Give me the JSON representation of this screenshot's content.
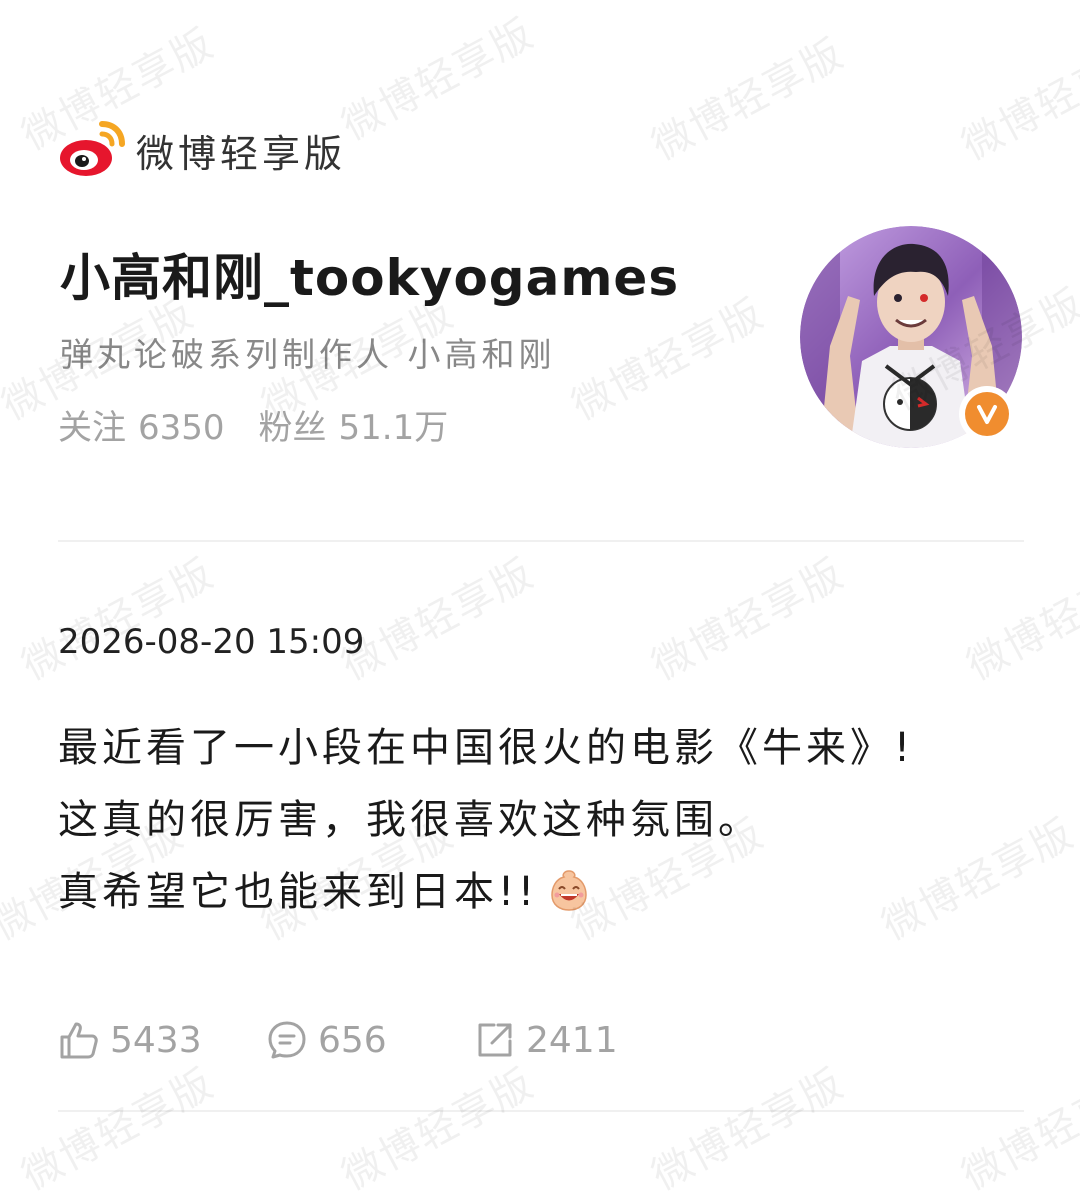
{
  "brand": {
    "app_name": "微博轻享版",
    "logo_icon": "weibo-logo-icon"
  },
  "profile": {
    "username": "小高和刚_tookyogames",
    "bio": "弹丸论破系列制作人 小高和刚",
    "following_label": "关注",
    "following_count": "6350",
    "followers_label": "粉丝",
    "followers_count": "51.1万",
    "verified_icon": "verified-v-icon"
  },
  "post": {
    "timestamp": "2026-08-20 15:09",
    "lines": [
      "最近看了一小段在中国很火的电影《牛来》!",
      "这真的很厉害，我很喜欢这种氛围。",
      "真希望它也能来到日本!!"
    ],
    "emoji_icon": "laughing-emoji-icon"
  },
  "actions": {
    "likes": "5433",
    "comments": "656",
    "reposts": "2411"
  },
  "watermark": "微博轻享版",
  "colors": {
    "weibo_red": "#e6162d",
    "weibo_orange": "#f5a623",
    "verified_orange": "#f08d2f",
    "muted_text": "#a3a3a3"
  }
}
